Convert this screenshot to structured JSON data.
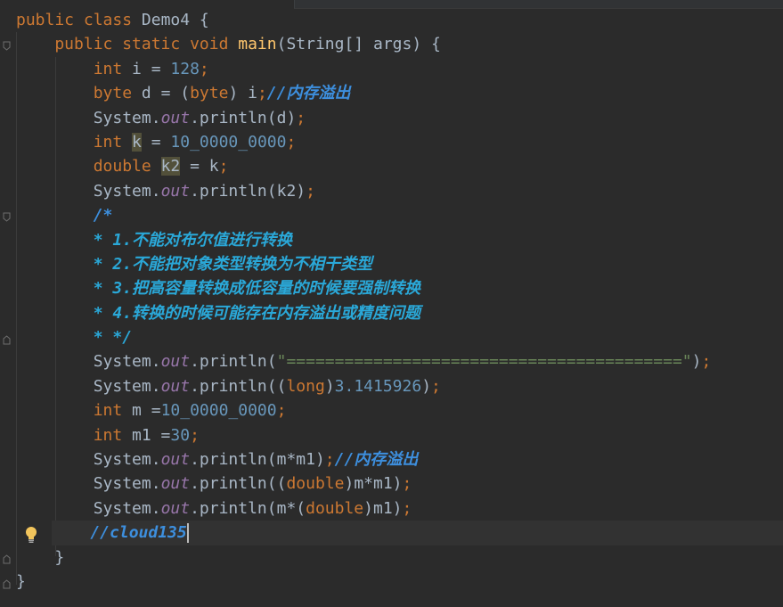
{
  "code_lines": [
    {
      "segments": [
        {
          "t": "public class ",
          "c": "kw"
        },
        {
          "t": "Demo4 {",
          "c": ""
        }
      ]
    },
    {
      "segments": [
        {
          "t": "    public static void ",
          "c": "kw"
        },
        {
          "t": "main",
          "c": "fn"
        },
        {
          "t": "(String[] args) {",
          "c": ""
        }
      ]
    },
    {
      "segments": [
        {
          "t": "        int ",
          "c": "kw"
        },
        {
          "t": "i = ",
          "c": ""
        },
        {
          "t": "128",
          "c": "num"
        },
        {
          "t": ";",
          "c": "kw"
        }
      ]
    },
    {
      "segments": [
        {
          "t": "        byte ",
          "c": "kw"
        },
        {
          "t": "d = (",
          "c": ""
        },
        {
          "t": "byte",
          "c": "kw"
        },
        {
          "t": ") i",
          "c": ""
        },
        {
          "t": ";",
          "c": "kw"
        },
        {
          "t": "//内存溢出",
          "c": "cmt"
        }
      ]
    },
    {
      "segments": [
        {
          "t": "        System.",
          "c": ""
        },
        {
          "t": "out",
          "c": "field"
        },
        {
          "t": ".println(d)",
          "c": ""
        },
        {
          "t": ";",
          "c": "kw"
        }
      ]
    },
    {
      "segments": [
        {
          "t": "        int ",
          "c": "kw"
        },
        {
          "t": "k",
          "c": "hl"
        },
        {
          "t": " = ",
          "c": ""
        },
        {
          "t": "10_0000_0000",
          "c": "num"
        },
        {
          "t": ";",
          "c": "kw"
        }
      ]
    },
    {
      "segments": [
        {
          "t": "        double ",
          "c": "kw"
        },
        {
          "t": "k2",
          "c": "hl"
        },
        {
          "t": " = k",
          "c": ""
        },
        {
          "t": ";",
          "c": "kw"
        }
      ]
    },
    {
      "segments": [
        {
          "t": "        System.",
          "c": ""
        },
        {
          "t": "out",
          "c": "field"
        },
        {
          "t": ".println(k2)",
          "c": ""
        },
        {
          "t": ";",
          "c": "kw"
        }
      ]
    },
    {
      "segments": [
        {
          "t": "        /*",
          "c": "cmt"
        }
      ]
    },
    {
      "segments": [
        {
          "t": "        * 1.不能对布尔值进行转换",
          "c": "cmt-doc"
        }
      ]
    },
    {
      "segments": [
        {
          "t": "        * 2.不能把对象类型转换为不相干类型",
          "c": "cmt-doc"
        }
      ]
    },
    {
      "segments": [
        {
          "t": "        * 3.把高容量转换成低容量的时候要强制转换",
          "c": "cmt-doc"
        }
      ]
    },
    {
      "segments": [
        {
          "t": "        * 4.转换的时候可能存在内存溢出或精度问题",
          "c": "cmt-doc"
        }
      ]
    },
    {
      "segments": [
        {
          "t": "        * */",
          "c": "cmt-doc"
        }
      ]
    },
    {
      "segments": [
        {
          "t": "        System.",
          "c": ""
        },
        {
          "t": "out",
          "c": "field"
        },
        {
          "t": ".println(",
          "c": ""
        },
        {
          "t": "\"=========================================\"",
          "c": "str"
        },
        {
          "t": ")",
          "c": ""
        },
        {
          "t": ";",
          "c": "kw"
        }
      ]
    },
    {
      "segments": [
        {
          "t": "        System.",
          "c": ""
        },
        {
          "t": "out",
          "c": "field"
        },
        {
          "t": ".println((",
          "c": ""
        },
        {
          "t": "long",
          "c": "kw"
        },
        {
          "t": ")",
          "c": ""
        },
        {
          "t": "3.1415926",
          "c": "num"
        },
        {
          "t": ")",
          "c": ""
        },
        {
          "t": ";",
          "c": "kw"
        }
      ]
    },
    {
      "segments": [
        {
          "t": "        int ",
          "c": "kw"
        },
        {
          "t": "m =",
          "c": ""
        },
        {
          "t": "10_0000_0000",
          "c": "num"
        },
        {
          "t": ";",
          "c": "kw"
        }
      ]
    },
    {
      "segments": [
        {
          "t": "        int ",
          "c": "kw"
        },
        {
          "t": "m1 =",
          "c": ""
        },
        {
          "t": "30",
          "c": "num"
        },
        {
          "t": ";",
          "c": "kw"
        }
      ]
    },
    {
      "segments": [
        {
          "t": "        System.",
          "c": ""
        },
        {
          "t": "out",
          "c": "field"
        },
        {
          "t": ".println(m*m1)",
          "c": ""
        },
        {
          "t": ";",
          "c": "kw"
        },
        {
          "t": "//内存溢出",
          "c": "cmt"
        }
      ]
    },
    {
      "segments": [
        {
          "t": "        System.",
          "c": ""
        },
        {
          "t": "out",
          "c": "field"
        },
        {
          "t": ".println((",
          "c": ""
        },
        {
          "t": "double",
          "c": "kw"
        },
        {
          "t": ")m*m1)",
          "c": ""
        },
        {
          "t": ";",
          "c": "kw"
        }
      ]
    },
    {
      "segments": [
        {
          "t": "        System.",
          "c": ""
        },
        {
          "t": "out",
          "c": "field"
        },
        {
          "t": ".println(m*(",
          "c": ""
        },
        {
          "t": "double",
          "c": "kw"
        },
        {
          "t": ")m1)",
          "c": ""
        },
        {
          "t": ";",
          "c": "kw"
        }
      ]
    },
    {
      "segments": [
        {
          "t": "        //cloud135",
          "c": "cmt"
        }
      ],
      "current": true
    },
    {
      "segments": [
        {
          "t": "    }",
          "c": ""
        }
      ]
    },
    {
      "segments": [
        {
          "t": "}",
          "c": ""
        }
      ]
    }
  ],
  "icons": {
    "bulb": "lightbulb-icon",
    "fold": "fold-marker-icon"
  },
  "colors": {
    "background": "#2b2b2b",
    "keyword": "#cc7832",
    "number": "#6897bb",
    "method": "#ffc66d",
    "field": "#9876aa",
    "string": "#6a8759",
    "comment": "#3d8fde",
    "text": "#a9b7c6"
  }
}
